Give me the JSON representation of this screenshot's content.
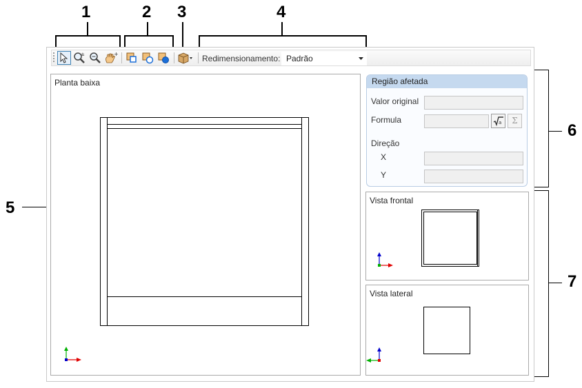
{
  "callouts": [
    "1",
    "2",
    "3",
    "4",
    "5",
    "6",
    "7"
  ],
  "toolbar": {
    "resize_label": "Redimensionamento:",
    "resize_value": "Padrão",
    "buttons": [
      {
        "name": "select-tool",
        "icon": "pointer-icon",
        "active": true
      },
      {
        "name": "zoom-tool",
        "icon": "zoom-plus-minus-icon"
      },
      {
        "name": "zoom-fit-tool",
        "icon": "zoom-fit-icon"
      },
      {
        "name": "pan-tool",
        "icon": "hand-icon"
      },
      {
        "name": "view-1",
        "icon": "layer-view-1-icon"
      },
      {
        "name": "view-2",
        "icon": "layer-view-2-icon"
      },
      {
        "name": "view-3",
        "icon": "layer-view-3-icon"
      },
      {
        "name": "3d-view",
        "icon": "cube-dropdown-icon"
      }
    ]
  },
  "plan": {
    "title": "Planta baixa"
  },
  "region": {
    "title": "Região afetada",
    "original_value_label": "Valor original",
    "formula_label": "Formula",
    "direction_label": "Direção",
    "x_label": "X",
    "y_label": "Y",
    "formula_editor_icon": "sqrt-icon",
    "sum_icon": "sigma-icon",
    "sum_glyph": "Σ"
  },
  "front_view": {
    "title": "Vista frontal"
  },
  "side_view": {
    "title": "Vista lateral"
  },
  "colors": {
    "header_blue": "#c5d9ef",
    "axis_red": "#e00000",
    "axis_blue": "#0000cc",
    "axis_green": "#00b000"
  }
}
